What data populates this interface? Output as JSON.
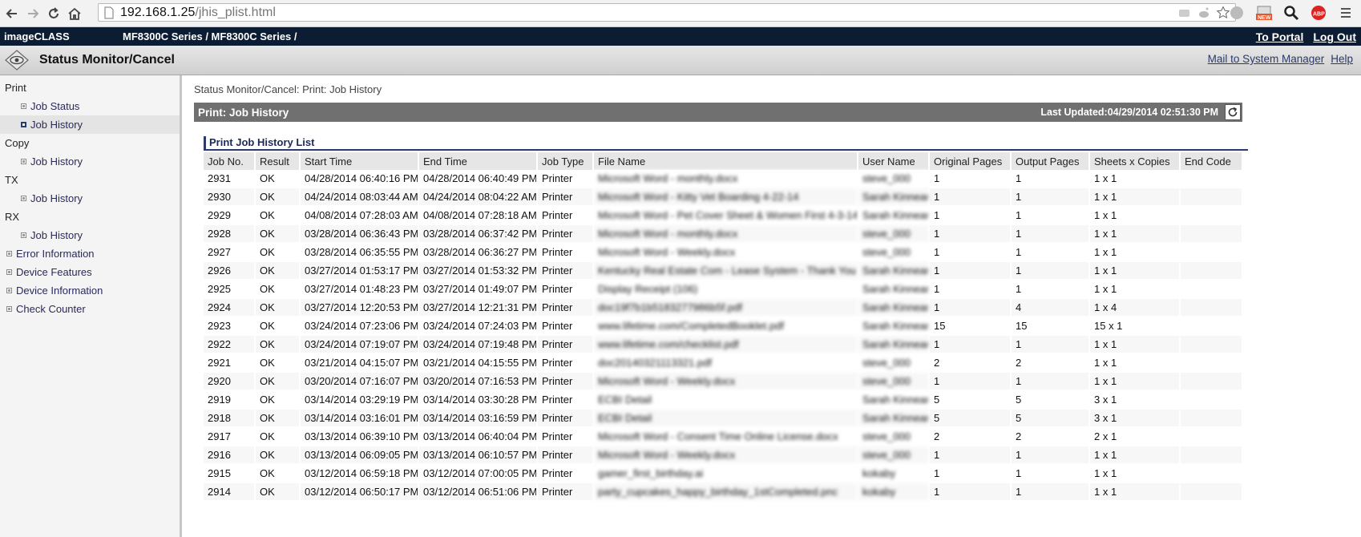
{
  "browser": {
    "url_host": "192.168.1.25",
    "url_path": "/jhis_plist.html"
  },
  "header": {
    "brand": "imageCLASS",
    "series": "MF8300C Series / MF8300C Series /",
    "to_portal": "To Portal",
    "log_out": "Log Out"
  },
  "titlebar": {
    "title": "Status Monitor/Cancel",
    "mail_link": "Mail to System Manager",
    "help_link": "Help"
  },
  "sidebar": {
    "print_group": "Print",
    "print_job_status": "Job Status",
    "print_job_history": "Job History",
    "copy_group": "Copy",
    "copy_job_history": "Job History",
    "tx_group": "TX",
    "tx_job_history": "Job History",
    "rx_group": "RX",
    "rx_job_history": "Job History",
    "error_information": "Error Information",
    "device_features": "Device Features",
    "device_information": "Device Information",
    "check_counter": "Check Counter"
  },
  "main": {
    "breadcrumb": "Status Monitor/Cancel: Print: Job History",
    "section_title": "Print: Job History",
    "last_updated": "Last Updated:04/29/2014 02:51:30 PM",
    "list_title": "Print Job History List",
    "columns": [
      "Job No.",
      "Result",
      "Start Time",
      "End Time",
      "Job Type",
      "File Name",
      "User Name",
      "Original Pages",
      "Output Pages",
      "Sheets x Copies",
      "End Code"
    ],
    "rows": [
      [
        "2931",
        "OK",
        "04/28/2014 06:40:16 PM",
        "04/28/2014 06:40:49 PM",
        "Printer",
        "Microsoft Word - monthly.docx",
        "steve_000",
        "1",
        "1",
        "1 x 1",
        ""
      ],
      [
        "2930",
        "OK",
        "04/24/2014 08:03:44 AM",
        "04/24/2014 08:04:22 AM",
        "Printer",
        "Microsoft Word - Kitty Vet Boarding 4-22-14",
        "Sarah Kinnear",
        "1",
        "1",
        "1 x 1",
        ""
      ],
      [
        "2929",
        "OK",
        "04/08/2014 07:28:03 AM",
        "04/08/2014 07:28:18 AM",
        "Printer",
        "Microsoft Word - Pet Cover Sheet & Women First 4-3-14",
        "Sarah Kinnear",
        "1",
        "1",
        "1 x 1",
        ""
      ],
      [
        "2928",
        "OK",
        "03/28/2014 06:36:43 PM",
        "03/28/2014 06:37:42 PM",
        "Printer",
        "Microsoft Word - monthly.docx",
        "steve_000",
        "1",
        "1",
        "1 x 1",
        ""
      ],
      [
        "2927",
        "OK",
        "03/28/2014 06:35:55 PM",
        "03/28/2014 06:36:27 PM",
        "Printer",
        "Microsoft Word - Weekly.docx",
        "steve_000",
        "1",
        "1",
        "1 x 1",
        ""
      ],
      [
        "2926",
        "OK",
        "03/27/2014 01:53:17 PM",
        "03/27/2014 01:53:32 PM",
        "Printer",
        "Kentucky Real Estate Com - Lease System - Thank You",
        "Sarah Kinnear",
        "1",
        "1",
        "1 x 1",
        ""
      ],
      [
        "2925",
        "OK",
        "03/27/2014 01:48:23 PM",
        "03/27/2014 01:49:07 PM",
        "Printer",
        "Display Receipt (106)",
        "Sarah Kinnear",
        "1",
        "1",
        "1 x 1",
        ""
      ],
      [
        "2924",
        "OK",
        "03/27/2014 12:20:53 PM",
        "03/27/2014 12:21:31 PM",
        "Printer",
        "doc19f7b1b5183277986b5f.pdf",
        "Sarah Kinnear",
        "1",
        "4",
        "1 x 4",
        ""
      ],
      [
        "2923",
        "OK",
        "03/24/2014 07:23:06 PM",
        "03/24/2014 07:24:03 PM",
        "Printer",
        "www.lifetime.com/CompletedBooklet.pdf",
        "Sarah Kinnear",
        "15",
        "15",
        "15 x 1",
        ""
      ],
      [
        "2922",
        "OK",
        "03/24/2014 07:19:07 PM",
        "03/24/2014 07:19:48 PM",
        "Printer",
        "www.lifetime.com/checklist.pdf",
        "Sarah Kinnear",
        "1",
        "1",
        "1 x 1",
        ""
      ],
      [
        "2921",
        "OK",
        "03/21/2014 04:15:07 PM",
        "03/21/2014 04:15:55 PM",
        "Printer",
        "doc20140321113321.pdf",
        "steve_000",
        "2",
        "2",
        "1 x 1",
        ""
      ],
      [
        "2920",
        "OK",
        "03/20/2014 07:16:07 PM",
        "03/20/2014 07:16:53 PM",
        "Printer",
        "Microsoft Word - Weekly.docx",
        "steve_000",
        "1",
        "1",
        "1 x 1",
        ""
      ],
      [
        "2919",
        "OK",
        "03/14/2014 03:29:19 PM",
        "03/14/2014 03:30:28 PM",
        "Printer",
        "ECBI Detail",
        "Sarah Kinnear",
        "5",
        "5",
        "3 x 1",
        ""
      ],
      [
        "2918",
        "OK",
        "03/14/2014 03:16:01 PM",
        "03/14/2014 03:16:59 PM",
        "Printer",
        "ECBI Detail",
        "Sarah Kinnear",
        "5",
        "5",
        "3 x 1",
        ""
      ],
      [
        "2917",
        "OK",
        "03/13/2014 06:39:10 PM",
        "03/13/2014 06:40:04 PM",
        "Printer",
        "Microsoft Word - Consent Time Online License.docx",
        "steve_000",
        "2",
        "2",
        "2 x 1",
        ""
      ],
      [
        "2916",
        "OK",
        "03/13/2014 06:09:05 PM",
        "03/13/2014 06:10:57 PM",
        "Printer",
        "Microsoft Word - Weekly.docx",
        "steve_000",
        "1",
        "1",
        "1 x 1",
        ""
      ],
      [
        "2915",
        "OK",
        "03/12/2014 06:59:18 PM",
        "03/12/2014 07:00:05 PM",
        "Printer",
        "gamer_first_birthday.ai",
        "kokaby",
        "1",
        "1",
        "1 x 1",
        ""
      ],
      [
        "2914",
        "OK",
        "03/12/2014 06:50:17 PM",
        "03/12/2014 06:51:06 PM",
        "Printer",
        "party_cupcakes_happy_birthday_1stCompleted.pnc",
        "kokaby",
        "1",
        "1",
        "1 x 1",
        ""
      ]
    ]
  },
  "colors": {
    "header_bg": "#0b1c33",
    "section_bar": "#707070",
    "accent": "#2a3a6a"
  },
  "icons": [
    "back-icon",
    "forward-icon",
    "reload-icon",
    "home-icon",
    "page-icon",
    "star-icon",
    "refresh-icon",
    "eye-logo-icon"
  ]
}
